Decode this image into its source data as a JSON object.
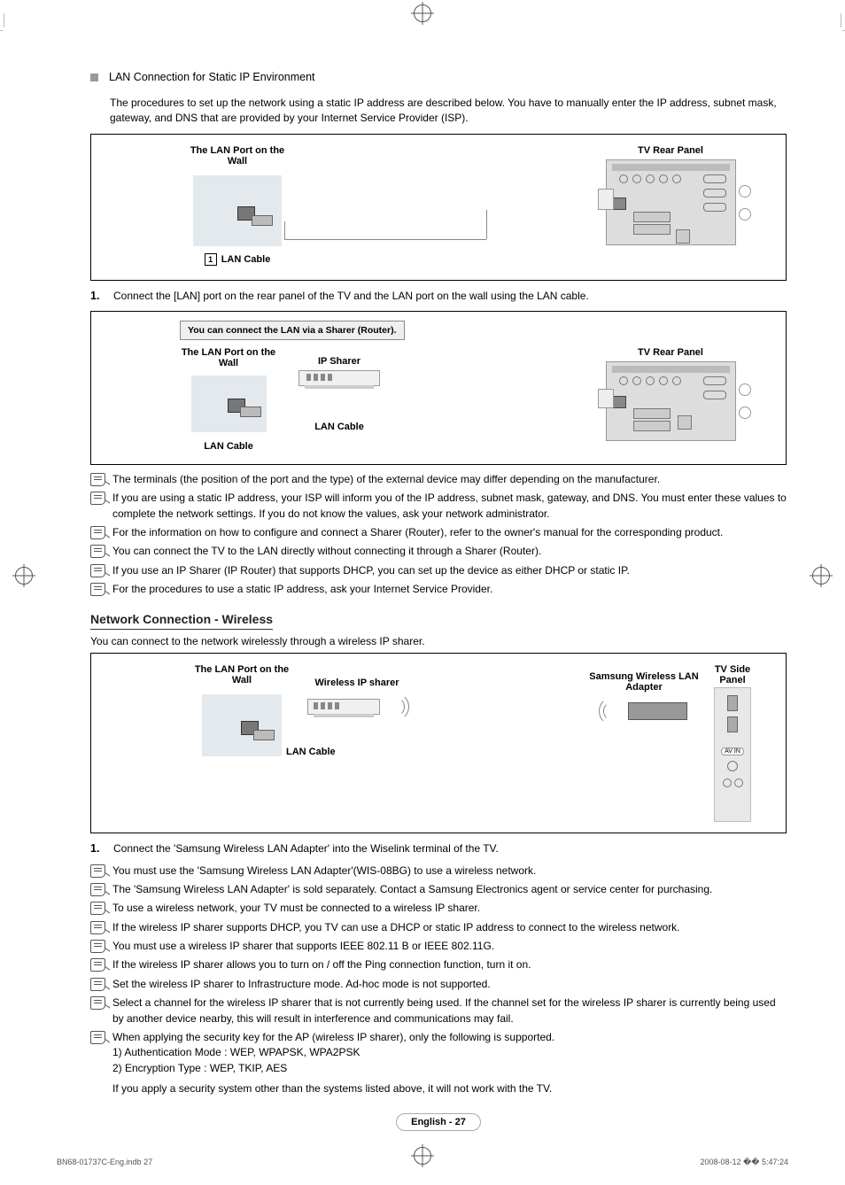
{
  "section1": {
    "title": "LAN Connection for Static IP Environment",
    "desc": "The procedures to set up the network using a static IP address are described below. You have to manually enter the IP address, subnet mask, gateway, and DNS that are provided by your Internet Service Provider (ISP)."
  },
  "diagram1": {
    "wallLabel": "The LAN Port on the Wall",
    "tvLabel": "TV Rear Panel",
    "cableNum": "1",
    "cableLabel": "LAN Cable"
  },
  "step1": {
    "num": "1.",
    "text": "Connect the [LAN] port on the rear panel of the TV and the LAN port on the wall using the LAN cable."
  },
  "diagram2": {
    "banner": "You can connect the LAN via a Sharer (Router).",
    "wallLabel": "The LAN Port on the Wall",
    "sharerLabel": "IP Sharer",
    "tvLabel": "TV Rear Panel",
    "cableLabel1": "LAN Cable",
    "cableLabel2": "LAN Cable"
  },
  "notes1": [
    "The terminals (the position of the port and the type) of the external device may differ depending on the manufacturer.",
    "If you are using a static IP address, your ISP will inform you of the IP address, subnet mask, gateway, and DNS. You must enter these values to complete the network settings. If you do not know the values, ask your network administrator.",
    "For the information on how to configure and connect a Sharer (Router), refer to the owner's manual for the corresponding product.",
    "You can connect the TV to the LAN directly without connecting it through a Sharer (Router).",
    "If you use an IP Sharer (IP Router) that supports DHCP, you can set up the device as either DHCP or static IP.",
    "For the procedures to use a static IP address, ask your Internet Service Provider."
  ],
  "section2": {
    "heading": "Network Connection - Wireless",
    "desc": "You can connect to the network wirelessly through a wireless IP sharer."
  },
  "diagram3": {
    "wallLabel": "The LAN Port on the Wall",
    "sharerLabel": "Wireless IP sharer",
    "adapterLabel": "Samsung Wireless LAN Adapter",
    "sideLabel": "TV Side Panel",
    "cableLabel": "LAN Cable",
    "avin": "AV IN"
  },
  "step2": {
    "num": "1.",
    "text": "Connect the 'Samsung Wireless LAN Adapter' into the Wiselink terminal of the TV."
  },
  "notes2": [
    "You must use the 'Samsung Wireless LAN Adapter'(WIS-08BG) to use a wireless network.",
    "The 'Samsung Wireless LAN Adapter' is sold separately. Contact a Samsung Electronics agent or service center for purchasing.",
    "To use a wireless network, your TV must be connected to a wireless IP sharer.",
    "If the wireless IP sharer supports DHCP, you TV can use a DHCP or static IP address to connect to the wireless network.",
    "You must use a wireless IP sharer that supports IEEE 802.11 B or IEEE 802.11G.",
    "If the wireless IP sharer allows you to turn on / off the Ping connection function, turn it on.",
    "Set the wireless IP sharer to Infrastructure mode. Ad-hoc mode is not supported.",
    "Select a channel for the wireless IP sharer that is not currently being used. If the channel set for the wireless IP sharer is currently being used by another device nearby, this will result in interference and communications may fail.",
    "When applying the security key for the AP (wireless IP sharer), only the following is supported."
  ],
  "security": {
    "line1": "1) Authentication Mode : WEP, WPAPSK, WPA2PSK",
    "line2": "2) Encryption Type : WEP, TKIP, AES",
    "line3": "If you apply a security system other than the systems listed above, it will not work with the TV."
  },
  "footer": {
    "pageLabel": "English - 27",
    "leftPrint": "BN68-01737C-Eng.indb   27",
    "rightPrint": "2008-08-12   �� 5:47:24"
  }
}
